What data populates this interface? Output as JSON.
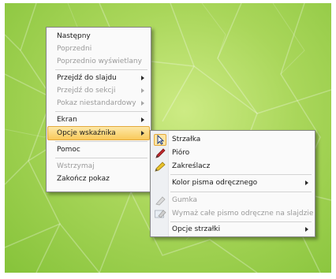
{
  "context_menu": {
    "items": [
      {
        "label": "Następny",
        "disabled": false
      },
      {
        "label": "Poprzedni",
        "disabled": true
      },
      {
        "label": "Poprzednio wyświetlany",
        "disabled": true
      },
      {
        "label": "Przejdź do slajdu",
        "disabled": false
      },
      {
        "label": "Przejdź do sekcji",
        "disabled": true
      },
      {
        "label": "Pokaz niestandardowy",
        "disabled": true
      },
      {
        "label": "Ekran",
        "disabled": false
      },
      {
        "label": "Opcje wskaźnika",
        "disabled": false
      },
      {
        "label": "Pomoc",
        "disabled": false
      },
      {
        "label": "Wstrzymaj",
        "disabled": true
      },
      {
        "label": "Zakończ pokaz",
        "disabled": false
      }
    ]
  },
  "submenu": {
    "items": [
      {
        "label": "Strzałka",
        "icon": "arrow-pointer-icon"
      },
      {
        "label": "Pióro",
        "icon": "pen-icon"
      },
      {
        "label": "Zakreślacz",
        "icon": "highlighter-icon"
      },
      {
        "label": "Kolor pisma odręcznego"
      },
      {
        "label": "Gumka",
        "icon": "eraser-icon",
        "disabled": true
      },
      {
        "label": "Wymaż całe pismo odręczne na slajdzie",
        "icon": "erase-all-icon",
        "disabled": true
      },
      {
        "label": "Opcje strzałki"
      }
    ]
  },
  "colors": {
    "menu_background": "#fafafa",
    "highlight": "#f9c95a",
    "slide_green": "#a9d65a"
  }
}
